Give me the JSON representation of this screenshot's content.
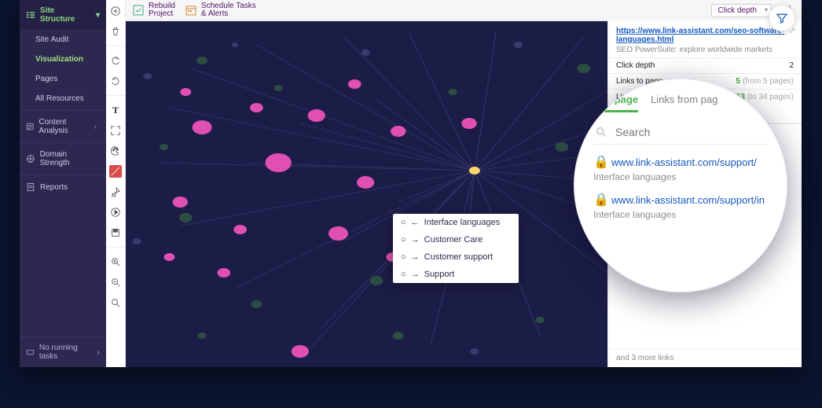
{
  "sidebar": {
    "title": "Site Structure",
    "items": [
      "Site Audit",
      "Visualization",
      "Pages",
      "All Resources"
    ],
    "active_index": 1,
    "sections": [
      {
        "label": "Content Analysis"
      },
      {
        "label": "Domain Strength"
      },
      {
        "label": "Reports"
      }
    ],
    "footer": "No running tasks"
  },
  "topbar": {
    "rebuild": "Rebuild\nProject",
    "schedule": "Schedule Tasks\n& Alerts",
    "click_depth_label": "Click depth"
  },
  "tooltip": {
    "rows": [
      {
        "dir": "←",
        "label": "Interface languages"
      },
      {
        "dir": "→",
        "label": "Customer Care"
      },
      {
        "dir": "→",
        "label": "Customer support"
      },
      {
        "dir": "→",
        "label": "Support"
      }
    ]
  },
  "rpanel": {
    "url": "https://www.link-assistant.com/seo-software-languages.html",
    "subtitle": "SEO PowerSuite: explore worldwide markets",
    "metrics": [
      {
        "k": "Click depth",
        "v": "2"
      },
      {
        "k": "Links to page",
        "v": "5",
        "note": "(from 5 pages)"
      },
      {
        "k": "Links from …",
        "v": "53",
        "note": "(to 34 pages)"
      }
    ],
    "legend": "Li",
    "footer": "and 3 more links"
  },
  "bubble": {
    "tabs": [
      "s to page",
      "Links from pag"
    ],
    "active_tab": 0,
    "search_placeholder": "Search",
    "results": [
      {
        "url": "www.link-assistant.com/support/",
        "caption": "Interface languages"
      },
      {
        "url": "www.link-assistant.com/support/in",
        "caption": "Interface languages"
      }
    ]
  }
}
